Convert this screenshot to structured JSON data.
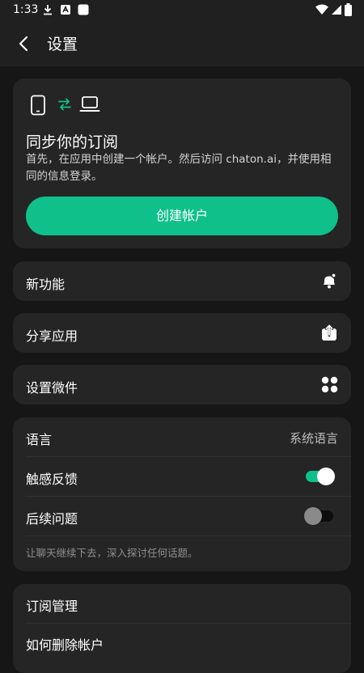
{
  "status": {
    "time": "1:33"
  },
  "appbar": {
    "title": "设置"
  },
  "sync": {
    "title": "同步你的订阅",
    "description": "首先，在应用中创建一个帐户。然后访问 chaton.ai，并使用相同的信息登录。",
    "button_label": "创建帐户",
    "accent": "#10c08a"
  },
  "menu": {
    "whats_new": "新功能",
    "share_app": "分享应用",
    "widgets": "设置微件"
  },
  "preferences": {
    "language_label": "语言",
    "language_value": "系统语言",
    "haptics_label": "触感反馈",
    "haptics_on": true,
    "followups_label": "后续问题",
    "followups_on": false,
    "followups_hint": "让聊天继续下去，深入探讨任何话题。"
  },
  "account": {
    "subscription": "订阅管理",
    "delete_account": "如何删除帐户"
  }
}
